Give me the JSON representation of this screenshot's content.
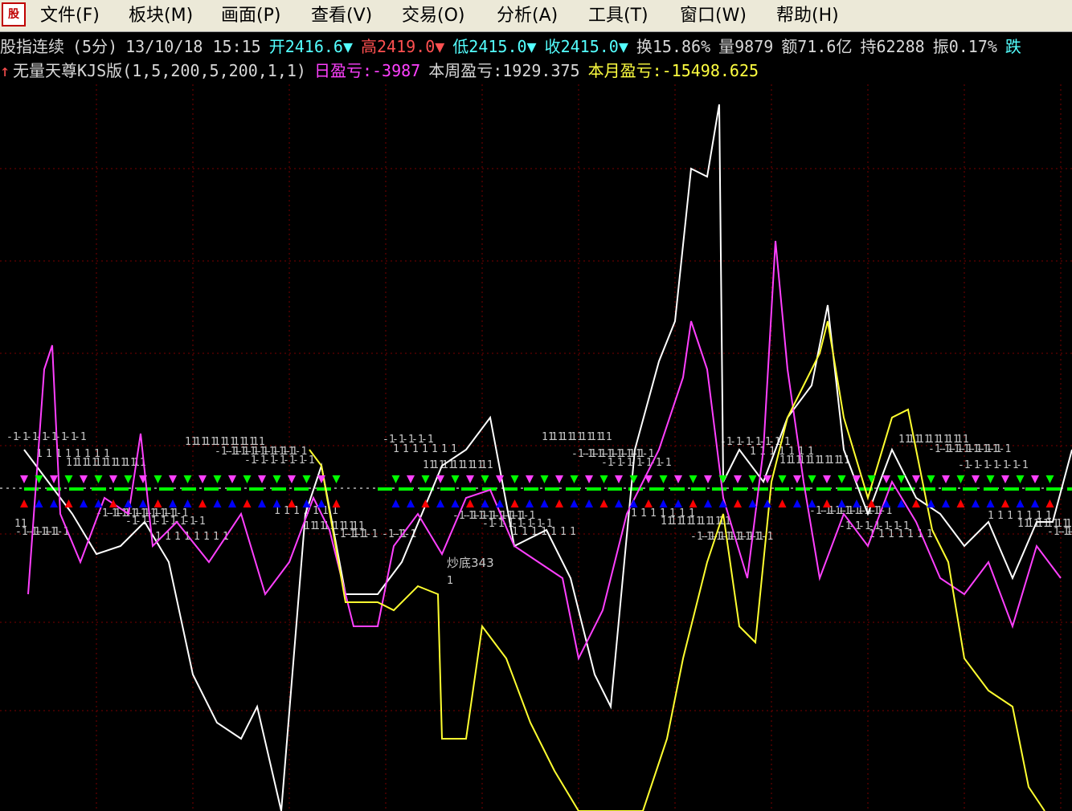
{
  "window": {
    "app_icon": "stock-chart-app-icon",
    "menu": [
      "文件(F)",
      "板块(M)",
      "画面(P)",
      "查看(V)",
      "交易(O)",
      "分析(A)",
      "工具(T)",
      "窗口(W)",
      "帮助(H)"
    ]
  },
  "quote_bar": {
    "name": "股指连续",
    "period": "(5分)",
    "datetime": "13/10/18 15:15",
    "open": "开2416.6▼",
    "high": "高2419.0▼",
    "low": "低2415.0▼",
    "close": "收2415.0▼",
    "turnover": "换15.86%",
    "volume": "量9879",
    "amount": "额71.6亿",
    "open_interest": "持62288",
    "amplitude": "振0.17%",
    "change": "跌"
  },
  "indicator_bar": {
    "arrow_icon": "red-up-arrow-icon",
    "formula": "无量天尊KJS版(1,5,200,5,200,1,1)",
    "daily_pnl": "日盈亏:-3987",
    "weekly_pnl": "本周盈亏:1929.375",
    "monthly_pnl": "本月盈亏:-15498.625"
  },
  "chart": {
    "annotation": "炒底343",
    "annotation_value": "1",
    "colors": {
      "grid": "#7a0000",
      "white_line": "#ffffff",
      "magenta_line": "#ff40ff",
      "yellow_line": "#ffff30",
      "band_text": "#c8c8c8",
      "green_dash": "#00ff00",
      "red_arrow": "#ff0000",
      "blue_triangle": "#0000ff",
      "magenta_triangle": "#ff40ff"
    }
  }
}
